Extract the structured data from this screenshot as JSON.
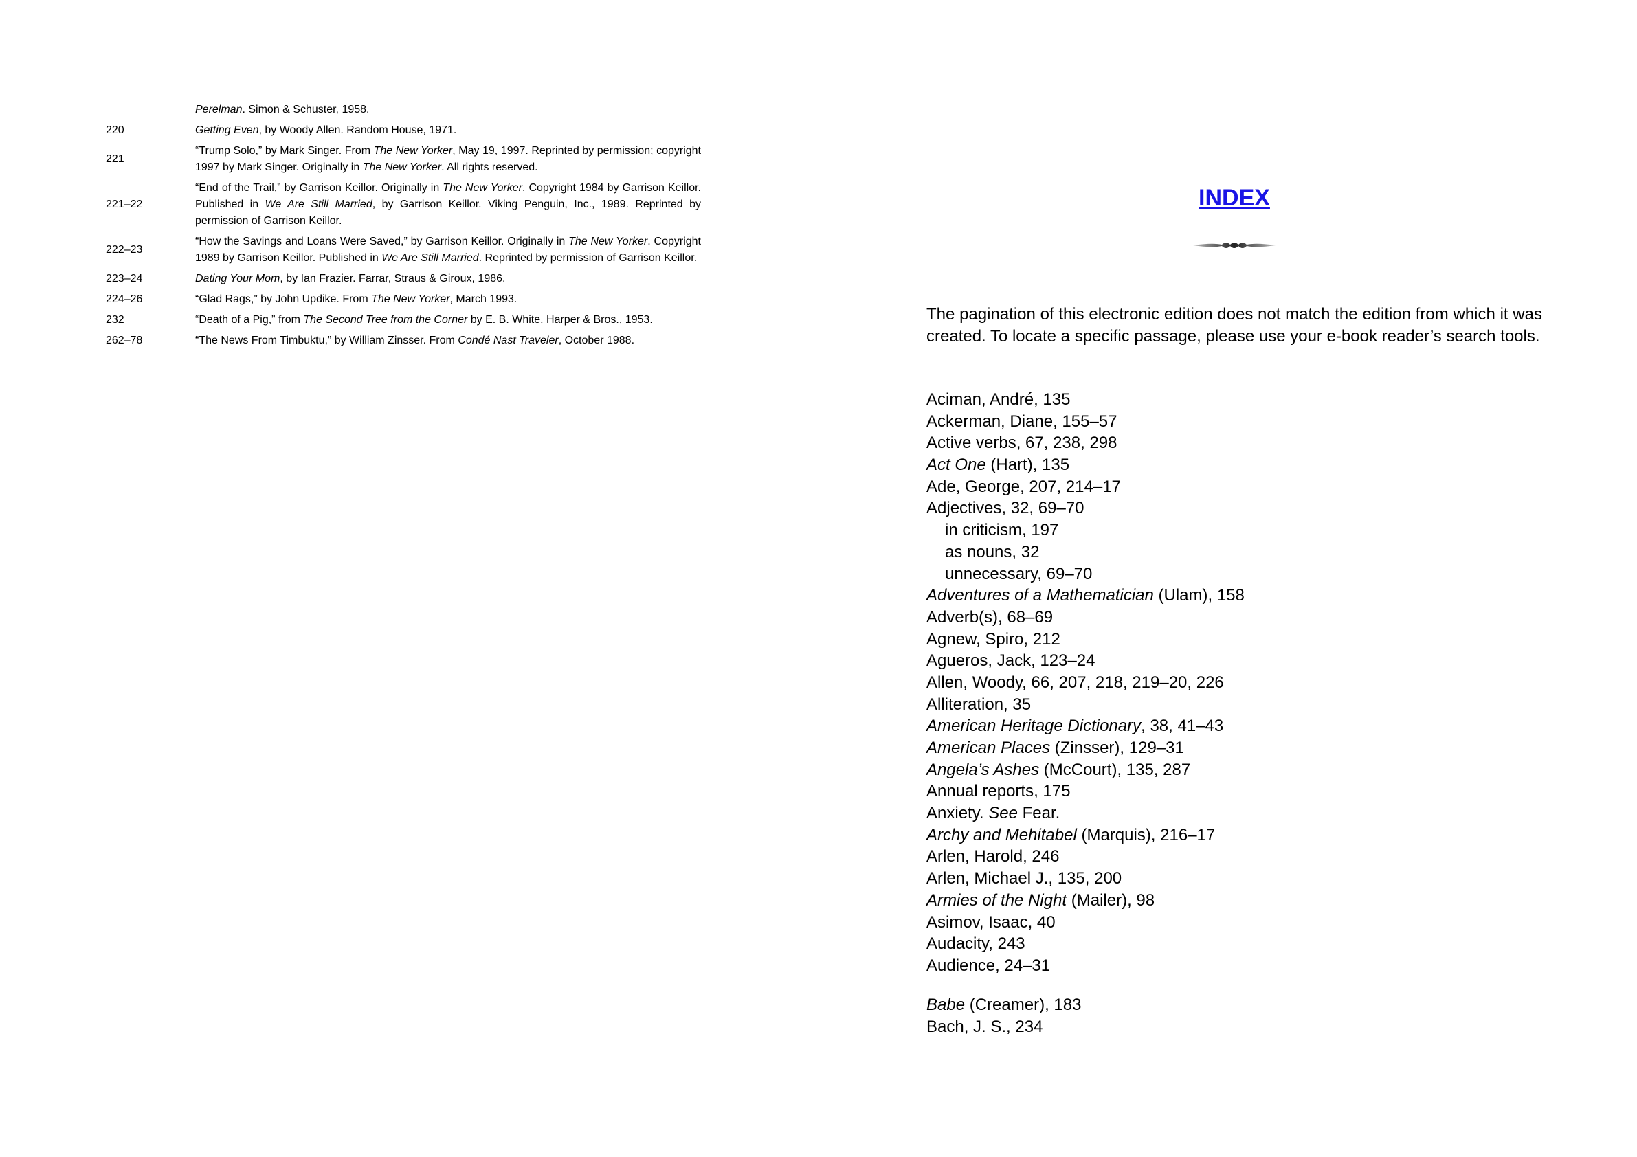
{
  "credits": [
    {
      "page": "",
      "parts": [
        {
          "t": "Perelman",
          "i": true
        },
        {
          "t": ". Simon & Schuster, 1958."
        }
      ]
    },
    {
      "page": "220",
      "parts": [
        {
          "t": "Getting Even",
          "i": true
        },
        {
          "t": ", by Woody Allen. Random House, 1971."
        }
      ]
    },
    {
      "page": "221",
      "parts": [
        {
          "t": "“Trump Solo,” by Mark Singer. From "
        },
        {
          "t": "The New Yorker",
          "i": true
        },
        {
          "t": ", May 19, 1997. Reprinted by permission; copyright 1997 by Mark Singer. Originally in "
        },
        {
          "t": "The New Yorker",
          "i": true
        },
        {
          "t": ". All rights reserved."
        }
      ]
    },
    {
      "page": "221–22",
      "parts": [
        {
          "t": "“End of the Trail,” by Garrison Keillor. Originally in "
        },
        {
          "t": "The New Yorker",
          "i": true
        },
        {
          "t": ". Copyright 1984 by Garrison Keillor. Published in "
        },
        {
          "t": "We Are Still Married",
          "i": true
        },
        {
          "t": ", by Garrison Keillor. Viking Penguin, Inc., 1989. Reprinted by permission of Garrison Keillor."
        }
      ]
    },
    {
      "page": "222–23",
      "parts": [
        {
          "t": "“How the Savings and Loans Were Saved,” by Garrison Keillor. Originally in "
        },
        {
          "t": "The New Yorker",
          "i": true
        },
        {
          "t": ". Copyright 1989 by Garrison Keillor. Published in "
        },
        {
          "t": "We Are Still Married",
          "i": true
        },
        {
          "t": ". Reprinted by permission of Garrison Keillor."
        }
      ]
    },
    {
      "page": "223–24",
      "parts": [
        {
          "t": "Dating Your Mom",
          "i": true
        },
        {
          "t": ", by Ian Frazier. Farrar, Straus & Giroux, 1986."
        }
      ]
    },
    {
      "page": "224–26",
      "parts": [
        {
          "t": "“Glad Rags,” by John Updike. From "
        },
        {
          "t": "The New Yorker",
          "i": true
        },
        {
          "t": ", March 1993."
        }
      ]
    },
    {
      "page": "232",
      "parts": [
        {
          "t": "“Death of a Pig,” from "
        },
        {
          "t": "The Second Tree from the Corner",
          "i": true
        },
        {
          "t": " by E. B. White. Harper & Bros., 1953."
        }
      ]
    },
    {
      "page": "262–78",
      "parts": [
        {
          "t": "“The News From Timbuktu,” by William Zinsser. From "
        },
        {
          "t": "Condé Nast Traveler",
          "i": true
        },
        {
          "t": ", October 1988."
        }
      ]
    }
  ],
  "index": {
    "title": "INDEX",
    "note": "The pagination of this electronic edition does not match the edition from which it was created. To locate a specific passage, please use your e-book reader’s search tools.",
    "link_color": "#1a14e6",
    "ornament_icon": "swash-divider-icon",
    "groups": [
      [
        {
          "parts": [
            {
              "t": "Aciman, André, 135"
            }
          ]
        },
        {
          "parts": [
            {
              "t": "Ackerman, Diane, 155–57"
            }
          ]
        },
        {
          "parts": [
            {
              "t": "Active verbs, 67, 238, 298"
            }
          ]
        },
        {
          "parts": [
            {
              "t": "Act One",
              "i": true
            },
            {
              "t": " (Hart), 135"
            }
          ]
        },
        {
          "parts": [
            {
              "t": "Ade, George, 207, 214–17"
            }
          ]
        },
        {
          "parts": [
            {
              "t": "Adjectives, 32, 69–70"
            }
          ]
        },
        {
          "sub": true,
          "parts": [
            {
              "t": "in criticism, 197"
            }
          ]
        },
        {
          "sub": true,
          "parts": [
            {
              "t": "as nouns, 32"
            }
          ]
        },
        {
          "sub": true,
          "parts": [
            {
              "t": "unnecessary, 69–70"
            }
          ]
        },
        {
          "parts": [
            {
              "t": "Adventures of a Mathematician",
              "i": true
            },
            {
              "t": " (Ulam), 158"
            }
          ]
        },
        {
          "parts": [
            {
              "t": "Adverb(s), 68–69"
            }
          ]
        },
        {
          "parts": [
            {
              "t": "Agnew, Spiro, 212"
            }
          ]
        },
        {
          "parts": [
            {
              "t": "Agueros, Jack, 123–24"
            }
          ]
        },
        {
          "parts": [
            {
              "t": "Allen, Woody, 66, 207, 218, 219–20, 226"
            }
          ]
        },
        {
          "parts": [
            {
              "t": "Alliteration, 35"
            }
          ]
        },
        {
          "parts": [
            {
              "t": "American Heritage Dictionary",
              "i": true
            },
            {
              "t": ", 38, 41–43"
            }
          ]
        },
        {
          "parts": [
            {
              "t": "American Places",
              "i": true
            },
            {
              "t": " (Zinsser), 129–31"
            }
          ]
        },
        {
          "parts": [
            {
              "t": "Angela’s Ashes",
              "i": true
            },
            {
              "t": " (McCourt), 135, 287"
            }
          ]
        },
        {
          "parts": [
            {
              "t": "Annual reports, 175"
            }
          ]
        },
        {
          "parts": [
            {
              "t": "Anxiety. "
            },
            {
              "t": "See",
              "i": true
            },
            {
              "t": " Fear."
            }
          ]
        },
        {
          "parts": [
            {
              "t": "Archy and Mehitabel",
              "i": true
            },
            {
              "t": " (Marquis), 216–17"
            }
          ]
        },
        {
          "parts": [
            {
              "t": "Arlen, Harold, 246"
            }
          ]
        },
        {
          "parts": [
            {
              "t": "Arlen, Michael J., 135, 200"
            }
          ]
        },
        {
          "parts": [
            {
              "t": "Armies of the Night",
              "i": true
            },
            {
              "t": " (Mailer), 98"
            }
          ]
        },
        {
          "parts": [
            {
              "t": "Asimov, Isaac, 40"
            }
          ]
        },
        {
          "parts": [
            {
              "t": "Audacity, 243"
            }
          ]
        },
        {
          "parts": [
            {
              "t": "Audience, 24–31"
            }
          ]
        }
      ],
      [
        {
          "parts": [
            {
              "t": "Babe",
              "i": true
            },
            {
              "t": " (Creamer), 183"
            }
          ]
        },
        {
          "parts": [
            {
              "t": "Bach, J. S., 234"
            }
          ]
        }
      ]
    ]
  }
}
